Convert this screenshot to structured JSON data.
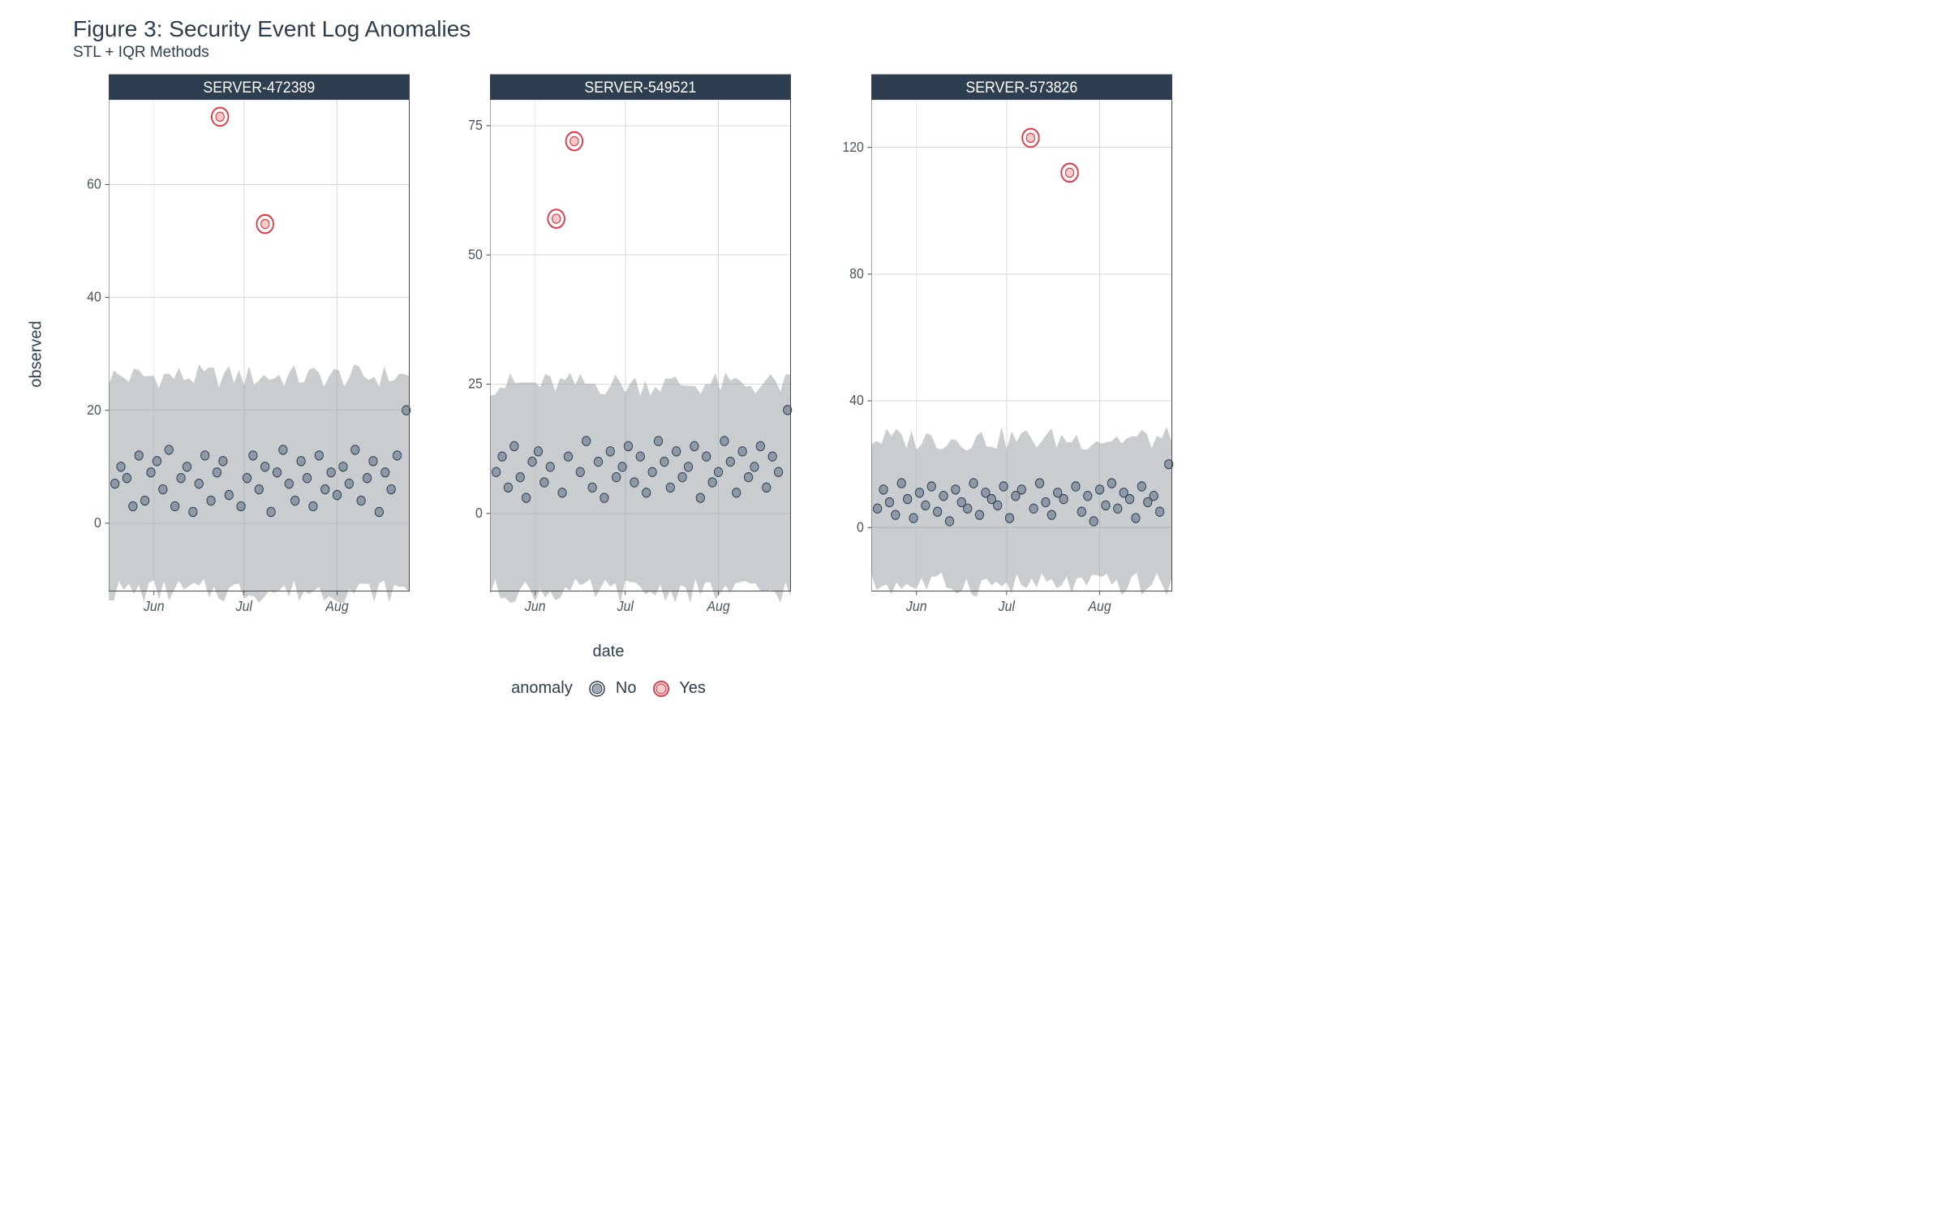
{
  "title": "Figure 3: Security Event Log Anomalies",
  "subtitle": "STL + IQR Methods",
  "ylabel": "observed",
  "xlabel": "date",
  "legend": {
    "title": "anomaly",
    "no": "No",
    "yes": "Yes"
  },
  "colors": {
    "strip_bg": "#2c3e50",
    "strip_text": "#ffffff",
    "grid": "#d6d9dc",
    "band": "#9ea4a9",
    "point_no_fill": "#6b7d8f",
    "point_no_stroke": "#2c3e50",
    "point_yes_fill": "#f7b9b9",
    "point_yes_stroke": "#e63946"
  },
  "chart_data": [
    {
      "type": "scatter",
      "facet": "SERVER-472389",
      "xlabel": "date",
      "ylabel": "observed",
      "x_ticks": [
        "Jun",
        "Jul",
        "Aug"
      ],
      "x_tick_positions": [
        15,
        45,
        76
      ],
      "x_range": [
        0,
        100
      ],
      "y_ticks": [
        0,
        20,
        40,
        60
      ],
      "y_range": [
        -12,
        75
      ],
      "band": {
        "lower_approx": -12,
        "upper_approx": 26
      },
      "series": [
        {
          "name": "No",
          "points": [
            {
              "x": 2,
              "y": 7
            },
            {
              "x": 4,
              "y": 10
            },
            {
              "x": 6,
              "y": 8
            },
            {
              "x": 8,
              "y": 3
            },
            {
              "x": 10,
              "y": 12
            },
            {
              "x": 12,
              "y": 4
            },
            {
              "x": 14,
              "y": 9
            },
            {
              "x": 16,
              "y": 11
            },
            {
              "x": 18,
              "y": 6
            },
            {
              "x": 20,
              "y": 13
            },
            {
              "x": 22,
              "y": 3
            },
            {
              "x": 24,
              "y": 8
            },
            {
              "x": 26,
              "y": 10
            },
            {
              "x": 28,
              "y": 2
            },
            {
              "x": 30,
              "y": 7
            },
            {
              "x": 32,
              "y": 12
            },
            {
              "x": 34,
              "y": 4
            },
            {
              "x": 36,
              "y": 9
            },
            {
              "x": 38,
              "y": 11
            },
            {
              "x": 40,
              "y": 5
            },
            {
              "x": 44,
              "y": 3
            },
            {
              "x": 46,
              "y": 8
            },
            {
              "x": 48,
              "y": 12
            },
            {
              "x": 50,
              "y": 6
            },
            {
              "x": 52,
              "y": 10
            },
            {
              "x": 54,
              "y": 2
            },
            {
              "x": 56,
              "y": 9
            },
            {
              "x": 58,
              "y": 13
            },
            {
              "x": 60,
              "y": 7
            },
            {
              "x": 62,
              "y": 4
            },
            {
              "x": 64,
              "y": 11
            },
            {
              "x": 66,
              "y": 8
            },
            {
              "x": 68,
              "y": 3
            },
            {
              "x": 70,
              "y": 12
            },
            {
              "x": 72,
              "y": 6
            },
            {
              "x": 74,
              "y": 9
            },
            {
              "x": 76,
              "y": 5
            },
            {
              "x": 78,
              "y": 10
            },
            {
              "x": 80,
              "y": 7
            },
            {
              "x": 82,
              "y": 13
            },
            {
              "x": 84,
              "y": 4
            },
            {
              "x": 86,
              "y": 8
            },
            {
              "x": 88,
              "y": 11
            },
            {
              "x": 90,
              "y": 2
            },
            {
              "x": 92,
              "y": 9
            },
            {
              "x": 94,
              "y": 6
            },
            {
              "x": 96,
              "y": 12
            },
            {
              "x": 99,
              "y": 20
            }
          ]
        },
        {
          "name": "Yes",
          "points": [
            {
              "x": 37,
              "y": 72
            },
            {
              "x": 52,
              "y": 53
            }
          ]
        }
      ]
    },
    {
      "type": "scatter",
      "facet": "SERVER-549521",
      "xlabel": "date",
      "ylabel": "observed",
      "x_ticks": [
        "Jun",
        "Jul",
        "Aug"
      ],
      "x_tick_positions": [
        15,
        45,
        76
      ],
      "x_range": [
        0,
        100
      ],
      "y_ticks": [
        0,
        25,
        50,
        75
      ],
      "y_range": [
        -15,
        80
      ],
      "band": {
        "lower_approx": -15,
        "upper_approx": 25
      },
      "series": [
        {
          "name": "No",
          "points": [
            {
              "x": 2,
              "y": 8
            },
            {
              "x": 4,
              "y": 11
            },
            {
              "x": 6,
              "y": 5
            },
            {
              "x": 8,
              "y": 13
            },
            {
              "x": 10,
              "y": 7
            },
            {
              "x": 12,
              "y": 3
            },
            {
              "x": 14,
              "y": 10
            },
            {
              "x": 16,
              "y": 12
            },
            {
              "x": 18,
              "y": 6
            },
            {
              "x": 20,
              "y": 9
            },
            {
              "x": 24,
              "y": 4
            },
            {
              "x": 26,
              "y": 11
            },
            {
              "x": 30,
              "y": 8
            },
            {
              "x": 32,
              "y": 14
            },
            {
              "x": 34,
              "y": 5
            },
            {
              "x": 36,
              "y": 10
            },
            {
              "x": 38,
              "y": 3
            },
            {
              "x": 40,
              "y": 12
            },
            {
              "x": 42,
              "y": 7
            },
            {
              "x": 44,
              "y": 9
            },
            {
              "x": 46,
              "y": 13
            },
            {
              "x": 48,
              "y": 6
            },
            {
              "x": 50,
              "y": 11
            },
            {
              "x": 52,
              "y": 4
            },
            {
              "x": 54,
              "y": 8
            },
            {
              "x": 56,
              "y": 14
            },
            {
              "x": 58,
              "y": 10
            },
            {
              "x": 60,
              "y": 5
            },
            {
              "x": 62,
              "y": 12
            },
            {
              "x": 64,
              "y": 7
            },
            {
              "x": 66,
              "y": 9
            },
            {
              "x": 68,
              "y": 13
            },
            {
              "x": 70,
              "y": 3
            },
            {
              "x": 72,
              "y": 11
            },
            {
              "x": 74,
              "y": 6
            },
            {
              "x": 76,
              "y": 8
            },
            {
              "x": 78,
              "y": 14
            },
            {
              "x": 80,
              "y": 10
            },
            {
              "x": 82,
              "y": 4
            },
            {
              "x": 84,
              "y": 12
            },
            {
              "x": 86,
              "y": 7
            },
            {
              "x": 88,
              "y": 9
            },
            {
              "x": 90,
              "y": 13
            },
            {
              "x": 92,
              "y": 5
            },
            {
              "x": 94,
              "y": 11
            },
            {
              "x": 96,
              "y": 8
            },
            {
              "x": 99,
              "y": 20
            }
          ]
        },
        {
          "name": "Yes",
          "points": [
            {
              "x": 22,
              "y": 57
            },
            {
              "x": 28,
              "y": 72
            }
          ]
        }
      ]
    },
    {
      "type": "scatter",
      "facet": "SERVER-573826",
      "xlabel": "date",
      "ylabel": "observed",
      "x_ticks": [
        "Jun",
        "Jul",
        "Aug"
      ],
      "x_tick_positions": [
        15,
        45,
        76
      ],
      "x_range": [
        0,
        100
      ],
      "y_ticks": [
        0,
        40,
        80,
        120
      ],
      "y_range": [
        -20,
        135
      ],
      "band": {
        "lower_approx": -18,
        "upper_approx": 28
      },
      "series": [
        {
          "name": "No",
          "points": [
            {
              "x": 2,
              "y": 6
            },
            {
              "x": 4,
              "y": 12
            },
            {
              "x": 6,
              "y": 8
            },
            {
              "x": 8,
              "y": 4
            },
            {
              "x": 10,
              "y": 14
            },
            {
              "x": 12,
              "y": 9
            },
            {
              "x": 14,
              "y": 3
            },
            {
              "x": 16,
              "y": 11
            },
            {
              "x": 18,
              "y": 7
            },
            {
              "x": 20,
              "y": 13
            },
            {
              "x": 22,
              "y": 5
            },
            {
              "x": 24,
              "y": 10
            },
            {
              "x": 26,
              "y": 2
            },
            {
              "x": 28,
              "y": 12
            },
            {
              "x": 30,
              "y": 8
            },
            {
              "x": 32,
              "y": 6
            },
            {
              "x": 34,
              "y": 14
            },
            {
              "x": 36,
              "y": 4
            },
            {
              "x": 38,
              "y": 11
            },
            {
              "x": 40,
              "y": 9
            },
            {
              "x": 42,
              "y": 7
            },
            {
              "x": 44,
              "y": 13
            },
            {
              "x": 46,
              "y": 3
            },
            {
              "x": 48,
              "y": 10
            },
            {
              "x": 50,
              "y": 12
            },
            {
              "x": 54,
              "y": 6
            },
            {
              "x": 56,
              "y": 14
            },
            {
              "x": 58,
              "y": 8
            },
            {
              "x": 60,
              "y": 4
            },
            {
              "x": 62,
              "y": 11
            },
            {
              "x": 64,
              "y": 9
            },
            {
              "x": 68,
              "y": 13
            },
            {
              "x": 70,
              "y": 5
            },
            {
              "x": 72,
              "y": 10
            },
            {
              "x": 74,
              "y": 2
            },
            {
              "x": 76,
              "y": 12
            },
            {
              "x": 78,
              "y": 7
            },
            {
              "x": 80,
              "y": 14
            },
            {
              "x": 82,
              "y": 6
            },
            {
              "x": 84,
              "y": 11
            },
            {
              "x": 86,
              "y": 9
            },
            {
              "x": 88,
              "y": 3
            },
            {
              "x": 90,
              "y": 13
            },
            {
              "x": 92,
              "y": 8
            },
            {
              "x": 94,
              "y": 10
            },
            {
              "x": 96,
              "y": 5
            },
            {
              "x": 99,
              "y": 20
            }
          ]
        },
        {
          "name": "Yes",
          "points": [
            {
              "x": 53,
              "y": 123
            },
            {
              "x": 66,
              "y": 112
            }
          ]
        }
      ]
    }
  ]
}
